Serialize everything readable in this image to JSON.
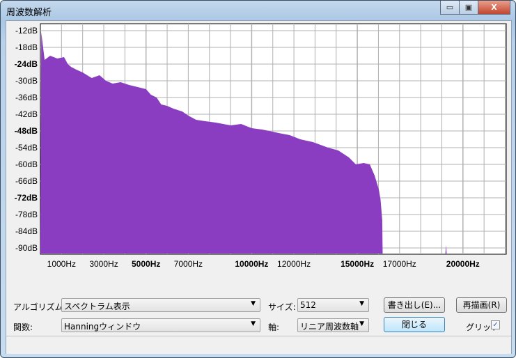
{
  "window": {
    "title": "周波数解析",
    "minimize": "▭",
    "maximize": "▣",
    "close": "X"
  },
  "colors": {
    "spectrum": "#8a3dc0",
    "grid": "#b0b0b0"
  },
  "chart_data": {
    "type": "area",
    "title": "",
    "xlabel": "",
    "ylabel": "",
    "xlim": [
      0,
      22050
    ],
    "ylim": [
      -92,
      -11
    ],
    "grid": true,
    "x_ticks": [
      {
        "label": "1000Hz",
        "value": 1000,
        "bold": false
      },
      {
        "label": "3000Hz",
        "value": 3000,
        "bold": false
      },
      {
        "label": "5000Hz",
        "value": 5000,
        "bold": true
      },
      {
        "label": "7000Hz",
        "value": 7000,
        "bold": false
      },
      {
        "label": "10000Hz",
        "value": 10000,
        "bold": true
      },
      {
        "label": "12000Hz",
        "value": 12000,
        "bold": false
      },
      {
        "label": "15000Hz",
        "value": 15000,
        "bold": true
      },
      {
        "label": "17000Hz",
        "value": 17000,
        "bold": false
      },
      {
        "label": "20000Hz",
        "value": 20000,
        "bold": true
      }
    ],
    "y_ticks": [
      {
        "label": "-12dB",
        "value": -12,
        "bold": false
      },
      {
        "label": "-18dB",
        "value": -18,
        "bold": false
      },
      {
        "label": "-24dB",
        "value": -24,
        "bold": true
      },
      {
        "label": "-30dB",
        "value": -30,
        "bold": false
      },
      {
        "label": "-36dB",
        "value": -36,
        "bold": false
      },
      {
        "label": "-42dB",
        "value": -42,
        "bold": false
      },
      {
        "label": "-48dB",
        "value": -48,
        "bold": true
      },
      {
        "label": "-54dB",
        "value": -54,
        "bold": false
      },
      {
        "label": "-60dB",
        "value": -60,
        "bold": false
      },
      {
        "label": "-66dB",
        "value": -66,
        "bold": false
      },
      {
        "label": "-72dB",
        "value": -72,
        "bold": true
      },
      {
        "label": "-78dB",
        "value": -78,
        "bold": false
      },
      {
        "label": "-84dB",
        "value": -84,
        "bold": false
      },
      {
        "label": "-90dB",
        "value": -90,
        "bold": false
      }
    ],
    "x": [
      0,
      40,
      200,
      460,
      800,
      1120,
      1300,
      1450,
      1700,
      2000,
      2430,
      2800,
      3100,
      3420,
      3800,
      4200,
      4740,
      5000,
      5230,
      5500,
      5720,
      6000,
      6300,
      6710,
      7000,
      7370,
      7800,
      8300,
      9010,
      9500,
      10000,
      10500,
      11320,
      11800,
      12300,
      12900,
      13620,
      14100,
      14600,
      14930,
      15300,
      15590,
      15820,
      16020,
      16100,
      16180,
      16200,
      19170,
      19200,
      19230
    ],
    "values": [
      -92,
      -12.5,
      -22.5,
      -21,
      -22,
      -21.5,
      -24,
      -25,
      -26,
      -27,
      -29,
      -28,
      -30,
      -31,
      -30.5,
      -31.5,
      -32.5,
      -33,
      -35,
      -36,
      -38.5,
      -39,
      -40,
      -41,
      -42.5,
      -44,
      -44.5,
      -45,
      -46,
      -45.5,
      -47,
      -47.5,
      -48.8,
      -49.5,
      -51,
      -52,
      -54,
      -55,
      -57.5,
      -60,
      -59.5,
      -60,
      -64,
      -69,
      -72.7,
      -80,
      -92,
      -92,
      -89,
      -92
    ]
  },
  "controls": {
    "algorithm_label": "アルゴリズム:",
    "algorithm_value": "スペクトラム表示",
    "size_label": "サイズ:",
    "size_value": "512",
    "export_button": "書き出し(E)...",
    "redraw_button": "再描画(R)",
    "function_label": "関数:",
    "function_value": "Hanningウィンドウ",
    "axis_label": "軸:",
    "axis_value": "リニア周波数軸",
    "close_button": "閉じる",
    "grid_label": "グリッド",
    "grid_checked": true,
    "dropdown_arrow": "▼",
    "check_mark": "✓"
  }
}
